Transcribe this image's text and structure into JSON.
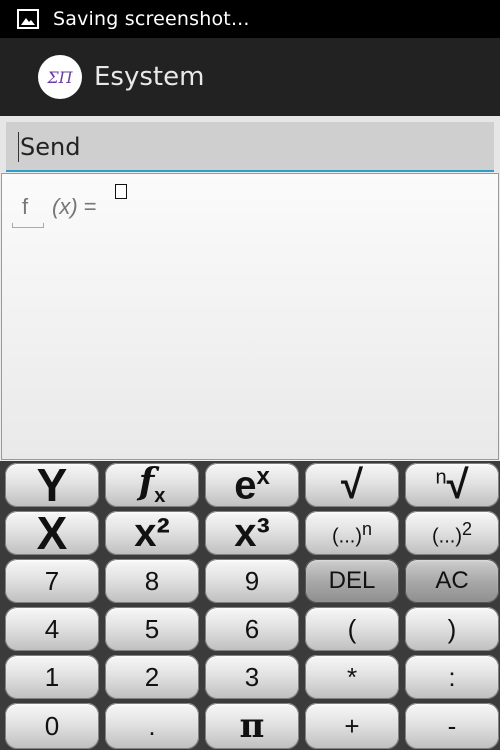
{
  "status_bar": {
    "text": "Saving screenshot...",
    "icon": "image-icon"
  },
  "action_bar": {
    "logo_text": "ΣΠ",
    "title": "Esystem"
  },
  "send_field": {
    "label": "Send"
  },
  "expression": {
    "function_name": "f",
    "argument": "(x)",
    "equals": "="
  },
  "keypad": {
    "rows": [
      [
        "Y",
        "fx",
        "eˣ",
        "√",
        "ⁿ√"
      ],
      [
        "X",
        "x²",
        "x³",
        "(...)ⁿ",
        "(...)²"
      ],
      [
        "7",
        "8",
        "9",
        "DEL",
        "AC"
      ],
      [
        "4",
        "5",
        "6",
        "(",
        ")"
      ],
      [
        "1",
        "2",
        "3",
        "*",
        ":"
      ],
      [
        "0",
        ".",
        "π",
        "+",
        "-"
      ]
    ]
  }
}
